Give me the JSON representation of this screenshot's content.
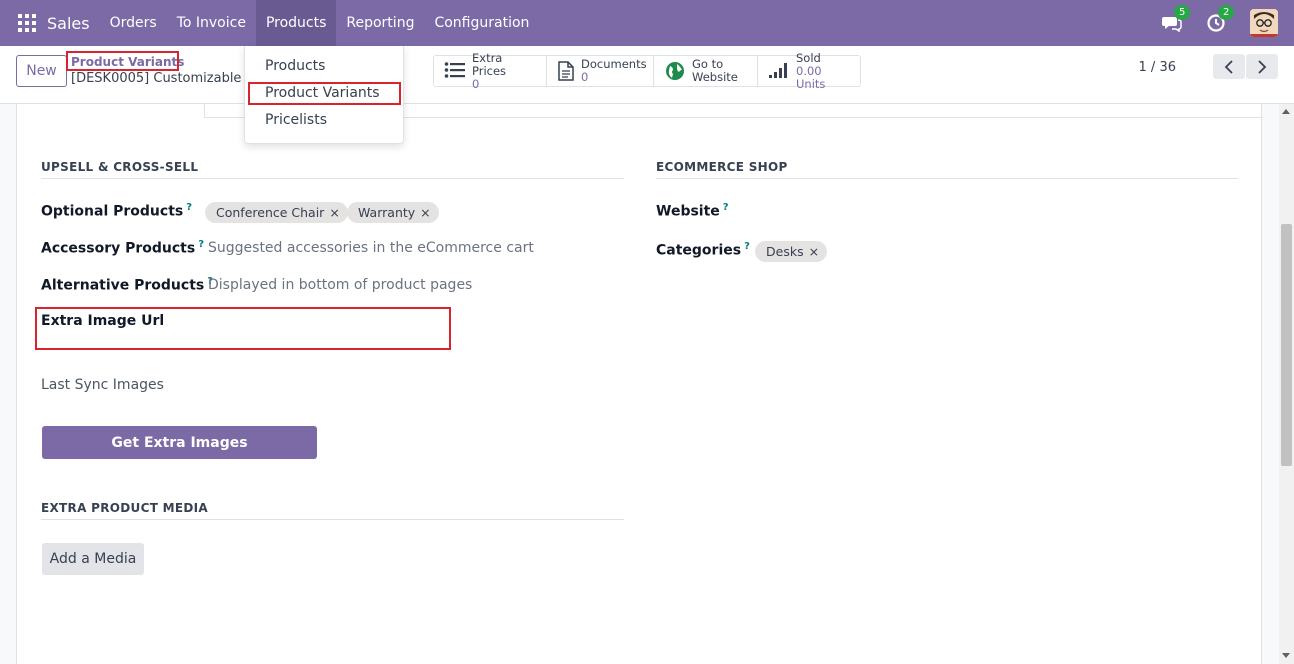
{
  "navbar": {
    "app_name": "Sales",
    "menu": [
      "Orders",
      "To Invoice",
      "Products",
      "Reporting",
      "Configuration"
    ],
    "messages_count": "5",
    "activities_count": "2"
  },
  "control_panel": {
    "new_label": "New",
    "breadcrumb_parent": "Product Variants",
    "breadcrumb_current": "[DESK0005] Customizable Desk",
    "stats": [
      {
        "icon": "list-icon",
        "label": "Extra Prices",
        "value": "0"
      },
      {
        "icon": "document-icon",
        "label": "Documents",
        "value": "0"
      },
      {
        "icon": "globe-icon",
        "label": "Go to",
        "value": "Website"
      },
      {
        "icon": "signal-bars-icon",
        "label": "Sold",
        "value": "0.00 Units"
      }
    ],
    "pager": "1 / 36"
  },
  "dropdown": {
    "items": [
      "Products",
      "Product Variants",
      "Pricelists"
    ]
  },
  "form": {
    "upsell_title": "UPSELL & CROSS-SELL",
    "optional_products_label": "Optional Products",
    "optional_products_tags": [
      "Conference Chair",
      "Warranty"
    ],
    "accessory_products_label": "Accessory Products",
    "accessory_products_placeholder": "Suggested accessories in the eCommerce cart",
    "alternative_products_label": "Alternative Products",
    "alternative_products_placeholder": "Displayed in bottom of product pages",
    "extra_image_url_label": "Extra Image Url",
    "last_sync_label": "Last Sync Images",
    "get_images_label": "Get Extra Images",
    "extra_media_title": "EXTRA PRODUCT MEDIA",
    "add_media_label": "Add a Media",
    "ecommerce_title": "ECOMMERCE SHOP",
    "website_label": "Website",
    "categories_label": "Categories",
    "categories_tags": [
      "Desks"
    ],
    "help_mark": "?",
    "tag_remove": "×"
  },
  "colors": {
    "primary": "#7c6aa6",
    "highlight": "#d9232d",
    "badge": "#28a745",
    "help": "#017e84"
  }
}
